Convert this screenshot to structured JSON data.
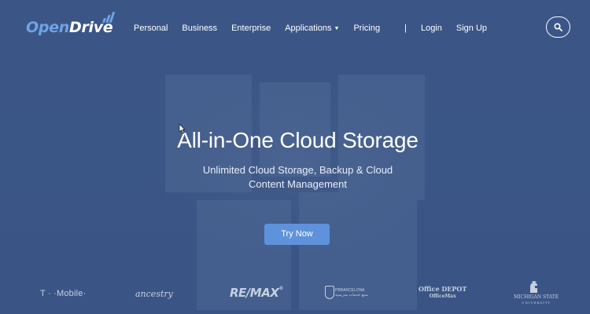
{
  "logo": {
    "part1": "Open",
    "part2": "Drive"
  },
  "nav": {
    "items": [
      "Personal",
      "Business",
      "Enterprise",
      "Applications",
      "Pricing"
    ],
    "separator": "|",
    "login": "Login",
    "signup": "Sign Up"
  },
  "hero": {
    "title": "All-in-One Cloud Storage",
    "subtitle_line1": "Unlimited Cloud Storage, Backup & Cloud",
    "subtitle_line2": "Content Management",
    "cta": "Try Now"
  },
  "brands": {
    "tmobile": "T · ·Mobile·",
    "ancestry": "ancestry",
    "remax": "RE/MAX",
    "remax_mark": "®",
    "pbl_line1": "PBBARCELONA",
    "pbl_line2": "سبع خدمات مدرسية",
    "officedepot_line1": "Office DEPOT",
    "officedepot_line2": "OfficeMax",
    "msu_line1": "MICHIGAN STATE",
    "msu_line2": "UNIVERSITY"
  },
  "icons": {
    "search": "search-icon",
    "caret": "chevron-down-icon",
    "cursor": "cursor-icon"
  },
  "colors": {
    "background": "#3a5585",
    "accent": "#6fa3e6",
    "cta": "#5f92dc"
  }
}
